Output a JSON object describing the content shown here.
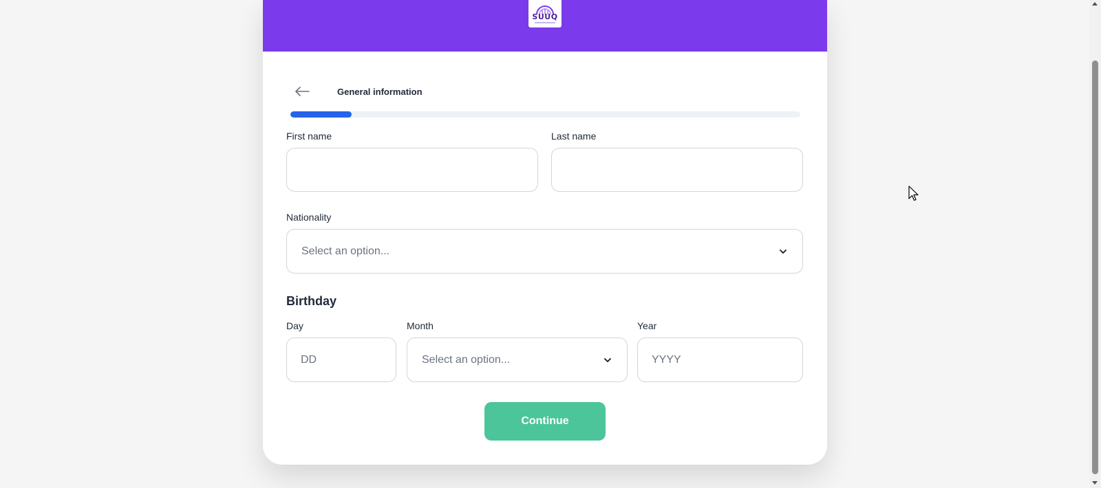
{
  "brand": {
    "logo_text": "SUUQ",
    "header_color": "#7c3aed",
    "accent_progress": "#2563eb",
    "button_color": "#4cc59a"
  },
  "step": {
    "title": "General information",
    "progress_fraction": 0.12
  },
  "form": {
    "first_name": {
      "label": "First name",
      "value": ""
    },
    "last_name": {
      "label": "Last name",
      "value": ""
    },
    "nationality": {
      "label": "Nationality",
      "selected": "Select an option..."
    },
    "birthday": {
      "heading": "Birthday",
      "day": {
        "label": "Day",
        "placeholder": "DD",
        "value": ""
      },
      "month": {
        "label": "Month",
        "selected": "Select an option..."
      },
      "year": {
        "label": "Year",
        "placeholder": "YYYY",
        "value": ""
      }
    },
    "continue_label": "Continue"
  },
  "icons": {
    "back": "arrow-left-icon",
    "dropdown": "chevron-down-icon",
    "cursor": "mouse-pointer-icon"
  }
}
